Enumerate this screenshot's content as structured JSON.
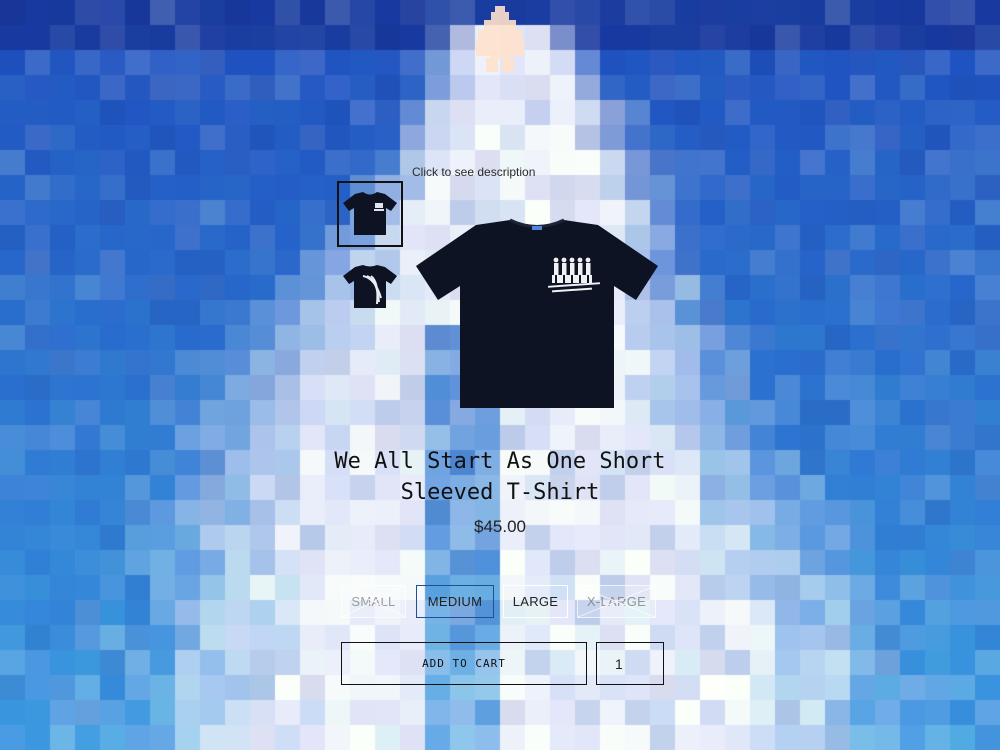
{
  "product": {
    "description_link": "Click to see description",
    "title_line1": "We All Start As One Short",
    "title_line2": "Sleeved T-Shirt",
    "price": "$45.00",
    "shirt_color": "#0d1322"
  },
  "sizes": [
    {
      "label": "SMALL",
      "available": false
    },
    {
      "label": "MEDIUM",
      "available": true,
      "selected": true
    },
    {
      "label": "LARGE",
      "available": true
    },
    {
      "label": "X-LARGE",
      "available": false
    }
  ],
  "cart": {
    "add_label": "ADD TO CART",
    "quantity": "1"
  },
  "icons": {
    "logo": "figure-logo-icon",
    "thumb_front": "tshirt-front-thumbnail",
    "thumb_back": "tshirt-back-thumbnail"
  },
  "colors": {
    "sky_blue": "#2f6fd0",
    "sky_light": "#5aa5e8",
    "cloud_white": "#f2f4f8",
    "logo_peach": "#ffe2cc"
  }
}
